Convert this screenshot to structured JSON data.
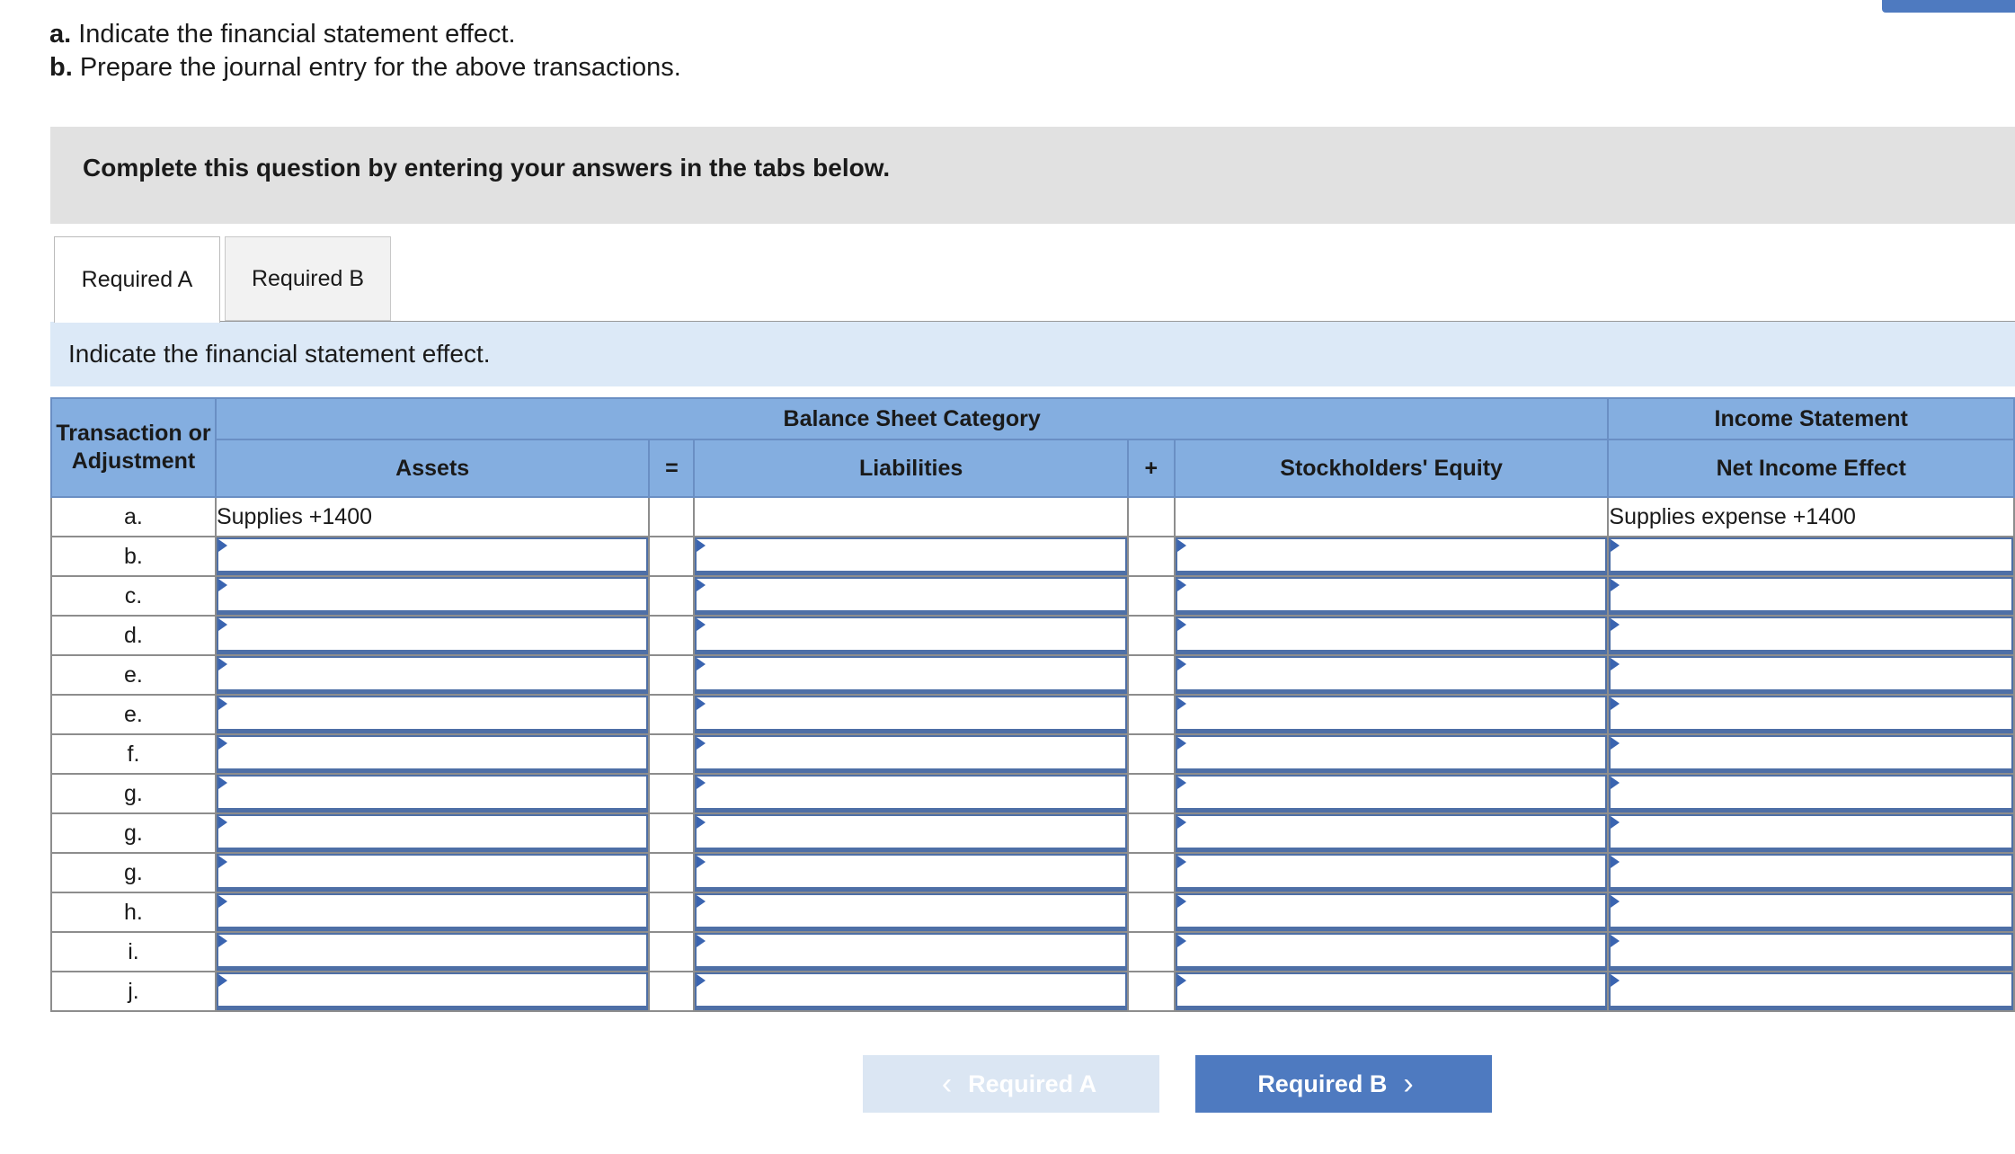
{
  "instructions": [
    {
      "letter": "a.",
      "text": "Indicate the financial statement effect."
    },
    {
      "letter": "b.",
      "text": "Prepare the journal entry for the above transactions."
    }
  ],
  "banner": "Complete this question by entering your answers in the tabs below.",
  "tabs": [
    {
      "label": "Required A",
      "active": true
    },
    {
      "label": "Required B",
      "active": false
    }
  ],
  "subheader": "Indicate the financial statement effect.",
  "table": {
    "col_transaction": "Transaction or Adjustment",
    "group_balance": "Balance Sheet Category",
    "group_income": "Income Statement",
    "col_assets": "Assets",
    "op_equals": "=",
    "col_liabilities": "Liabilities",
    "op_plus": "+",
    "col_equity": "Stockholders' Equity",
    "col_net_income": "Net Income Effect",
    "rows": [
      {
        "label": "a.",
        "assets": "Supplies +1400",
        "liabilities": "",
        "equity": "",
        "net_income": "Supplies expense +1400",
        "editable": false
      },
      {
        "label": "b.",
        "editable": true
      },
      {
        "label": "c.",
        "editable": true
      },
      {
        "label": "d.",
        "editable": true
      },
      {
        "label": "e.",
        "editable": true
      },
      {
        "label": "e.",
        "editable": true
      },
      {
        "label": "f.",
        "editable": true
      },
      {
        "label": "g.",
        "editable": true
      },
      {
        "label": "g.",
        "editable": true
      },
      {
        "label": "g.",
        "editable": true
      },
      {
        "label": "h.",
        "editable": true
      },
      {
        "label": "i.",
        "editable": true
      },
      {
        "label": "j.",
        "editable": true
      }
    ]
  },
  "nav": {
    "prev_label": "Required A",
    "next_label": "Required B",
    "prev_icon": "chevron-left-icon",
    "next_icon": "chevron-right-icon"
  },
  "colors": {
    "accent": "#4e7ac0",
    "header": "#84aee0",
    "subheader": "#dce9f7",
    "banner": "#e1e1e1"
  }
}
